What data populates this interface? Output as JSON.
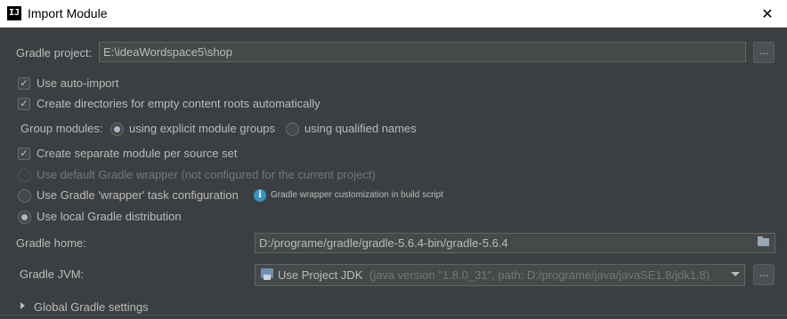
{
  "window": {
    "app_icon": "IJ",
    "title": "Import Module",
    "close_glyph": "✕"
  },
  "gradle_project": {
    "label": "Gradle project:",
    "value": "E:\\ideaWordspace5\\shop",
    "browse_label": "..."
  },
  "options": {
    "auto_import": {
      "label": "Use auto-import",
      "checked": true
    },
    "create_dirs": {
      "label": "Create directories for empty content roots automatically",
      "checked": true
    },
    "group_modules": {
      "label": "Group modules:",
      "explicit": "using explicit module groups",
      "qualified": "using qualified names",
      "selected": "explicit"
    },
    "separate_module": {
      "label": "Create separate module per source set",
      "checked": true
    }
  },
  "gradle_distribution": {
    "default_wrapper": "Use default Gradle wrapper (not configured for the current project)",
    "wrapper_task": "Use Gradle 'wrapper' task configuration",
    "wrapper_hint": "Gradle wrapper customization in build script",
    "local": "Use local Gradle distribution",
    "selected": "local"
  },
  "gradle_home": {
    "label": "Gradle home:",
    "value": "D:/programe/gradle/gradle-5.6.4-bin/gradle-5.6.4"
  },
  "gradle_jvm": {
    "label": "Gradle JVM:",
    "value": "Use Project JDK",
    "detail": "(java version \"1.8.0_31\", path: D:/programe/java/javaSE1.8/jdk1.8)",
    "browse_label": "..."
  },
  "global_settings": {
    "label": "Global Gradle settings"
  },
  "icons": {
    "check": "✓",
    "info": "i"
  }
}
